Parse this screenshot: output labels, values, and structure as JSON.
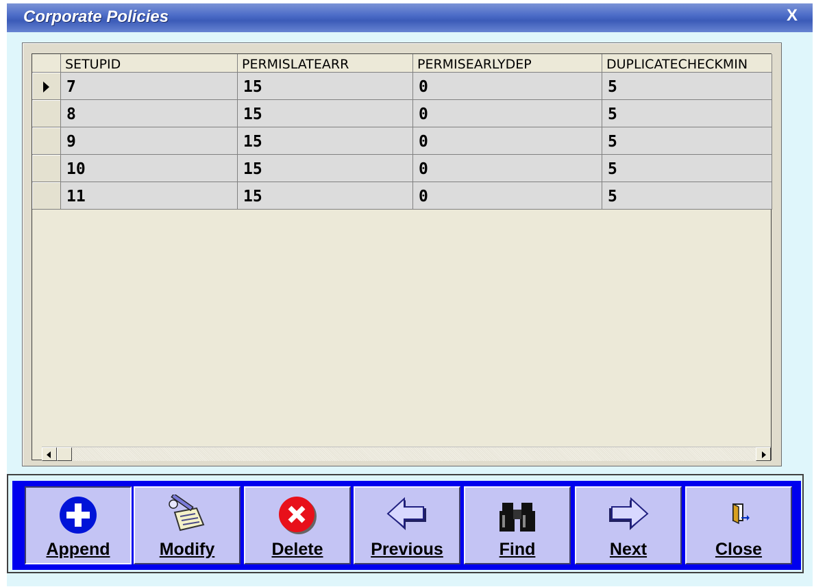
{
  "window": {
    "title": "Corporate Policies",
    "close_label": "X"
  },
  "grid": {
    "columns": [
      "SETUPID",
      "PERMISLATEARR",
      "PERMISEARLYDEP",
      "DUPLICATECHECKMIN"
    ],
    "rows": [
      [
        "7",
        "15",
        "0",
        "5"
      ],
      [
        "8",
        "15",
        "0",
        "5"
      ],
      [
        "9",
        "15",
        "0",
        "5"
      ],
      [
        "10",
        "15",
        "0",
        "5"
      ],
      [
        "11",
        "15",
        "0",
        "5"
      ]
    ],
    "current_row": 0
  },
  "toolbar": {
    "buttons": [
      {
        "label": "Append",
        "icon": "plus-circle-icon"
      },
      {
        "label": "Modify",
        "icon": "pen-notepad-icon"
      },
      {
        "label": "Delete",
        "icon": "delete-x-circle-icon"
      },
      {
        "label": "Previous",
        "icon": "arrow-left-icon"
      },
      {
        "label": "Find",
        "icon": "binoculars-icon"
      },
      {
        "label": "Next",
        "icon": "arrow-right-icon"
      },
      {
        "label": "Close",
        "icon": "exit-door-icon"
      }
    ]
  }
}
